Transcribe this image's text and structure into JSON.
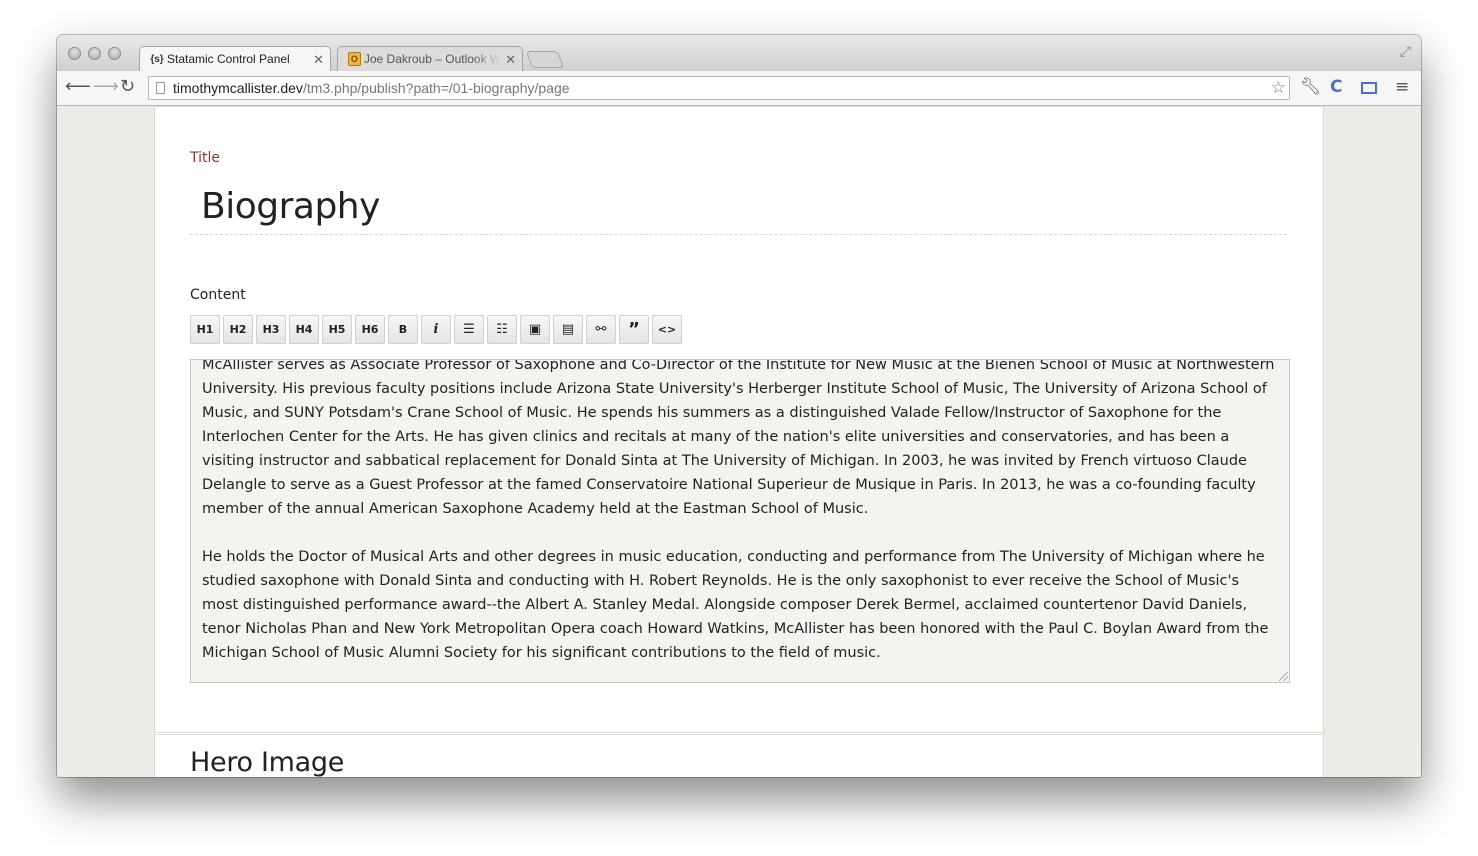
{
  "browser": {
    "tabs": [
      {
        "favicon": "{s}",
        "title": "Statamic Control Panel"
      },
      {
        "favicon": "O",
        "title": "Joe Dakroub – Outlook Web"
      }
    ],
    "url_host": "timothymcallister.dev",
    "url_path": "/tm3.php/publish?path=/01-biography/page",
    "icons": [
      "back-icon",
      "forward-icon",
      "reload-icon",
      "star-icon",
      "wrench-icon",
      "extension-icon",
      "screen-icon",
      "menu-icon"
    ]
  },
  "page": {
    "title_label": "Title",
    "title_value": "Biography",
    "content_label": "Content",
    "toolbar": {
      "h1": "H1",
      "h2": "H2",
      "h3": "H3",
      "h4": "H4",
      "h5": "H5",
      "h6": "H6",
      "bold": "B",
      "italic": "i",
      "ul": "☰",
      "ol": "☷",
      "image": "▣",
      "file": "▤",
      "link": "⚯",
      "quote": "”",
      "code": "<>"
    },
    "content_paragraphs": [
      "McAllister serves as Associate Professor of Saxophone and Co-Director of the Institute for New Music at the Bienen School of Music at Northwestern University.  His previous faculty positions include Arizona State University's Herberger Institute School of Music, The University of Arizona School of Music, and SUNY Potsdam's Crane School of Music.  He spends his summers as a distinguished Valade Fellow/Instructor of Saxophone for the Interlochen Center for the Arts.  He has given clinics and recitals at many of the nation's elite universities and conservatories, and has been a visiting instructor and sabbatical replacement for Donald Sinta at The University of Michigan. In 2003, he was invited by French virtuoso Claude Delangle to serve as a Guest Professor at the famed Conservatoire National Superieur de Musique in Paris. In 2013, he was a co-founding faculty member of the annual American Saxophone Academy held at the Eastman School of Music.",
      "He holds the Doctor of Musical Arts and other degrees in music education, conducting and performance from The University of Michigan where he studied saxophone with Donald Sinta and conducting with H. Robert Reynolds. He is the only saxophonist to ever receive the School of Music's most distinguished performance award--the Albert A. Stanley Medal. Alongside composer Derek Bermel, acclaimed countertenor David Daniels, tenor Nicholas Phan and New York Metropolitan Opera coach Howard Watkins, McAllister has been honored with the Paul C. Boylan Award from the Michigan School of Music Alumni Society for his significant contributions to the field of music."
    ],
    "next_section_heading": "Hero Image"
  }
}
